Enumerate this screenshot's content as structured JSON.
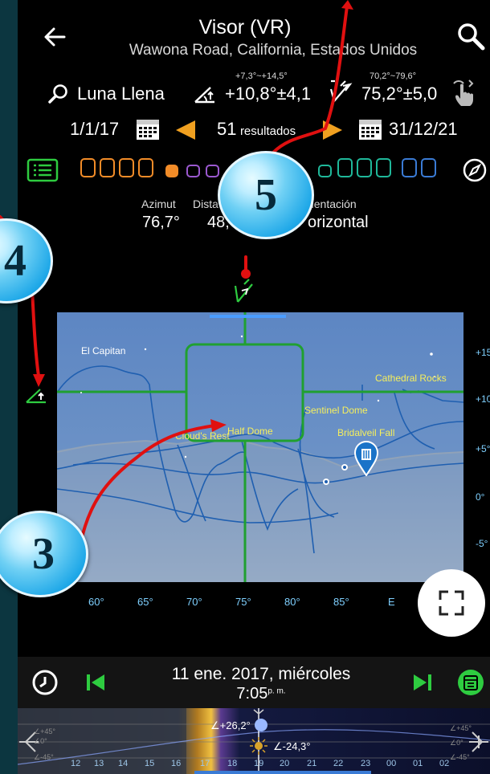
{
  "header": {
    "title": "Visor (VR)",
    "subtitle": "Wawona Road, California, Estados Unidos"
  },
  "search": {
    "label": "Luna Llena"
  },
  "altitude": {
    "range": "+7,3°~+14,5°",
    "value": "+10,8°±4,1"
  },
  "azimuth": {
    "range": "70,2°~79,6°",
    "value": "75,2°±5,0"
  },
  "dates": {
    "start": "1/1/17",
    "results": "51",
    "results_suffix": "resultados",
    "end": "31/12/21"
  },
  "info": {
    "az_label": "Azimut",
    "az_value": "76,7°",
    "dist_label": "Dista",
    "dist_value": "48,",
    "orient_label": "rientación",
    "orient_value": "orizontal"
  },
  "places": [
    "El Capitan",
    "Cathedral Rocks",
    "Sentinel Dome",
    "Cloud's Rest",
    "Half Dome",
    "Bridalveil Fall"
  ],
  "axis": {
    "bottom": [
      "60°",
      "65°",
      "70°",
      "75°",
      "80°",
      "85°",
      "E"
    ],
    "right": [
      "+15",
      "+10",
      "+5°",
      "0°",
      "-5°"
    ]
  },
  "timeline": {
    "date": "11 ene. 2017, miércoles",
    "time": "7:05",
    "ampm": "p. m.",
    "hours": [
      "12",
      "13",
      "14",
      "15",
      "16",
      "17",
      "18",
      "19",
      "20",
      "21",
      "22",
      "23",
      "00",
      "01",
      "02"
    ],
    "moon_alt": "∠+26,2°",
    "sun_alt": "∠-24,3°",
    "left_labels": [
      "∠+45°",
      "∠0°",
      "∠-45°"
    ],
    "right_labels": [
      "∠+45°",
      "∠0°",
      "∠-45°"
    ]
  },
  "callouts": {
    "c3": "3",
    "c4": "4",
    "c5": "5"
  },
  "colors": {
    "accent_green": "#2ecc40",
    "orange": "#f28c28",
    "purple": "#9b59d0",
    "teal": "#1fb89a",
    "blue": "#3a7bd5",
    "red_arrow": "#e01010"
  }
}
